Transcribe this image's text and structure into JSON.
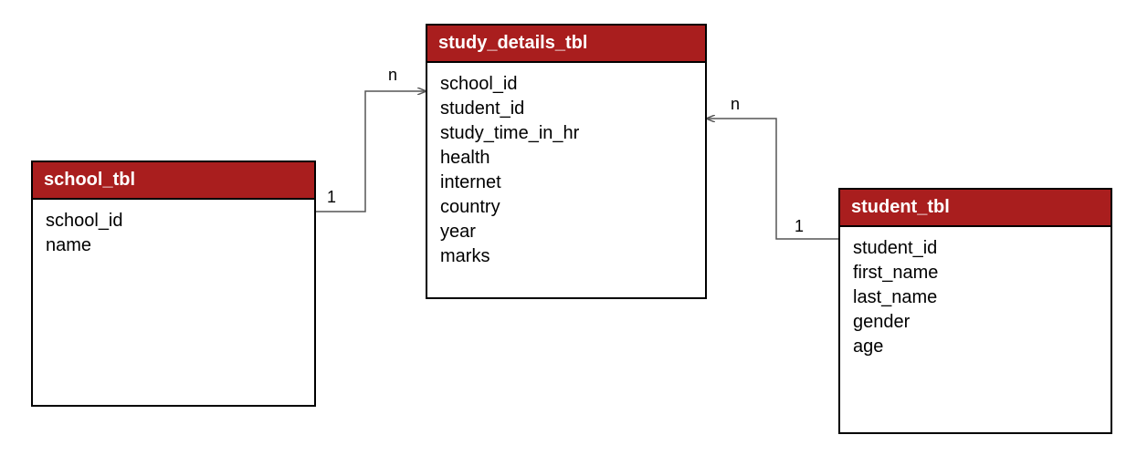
{
  "diagram": {
    "entities": {
      "school": {
        "title": "school_tbl",
        "fields": [
          "school_id",
          "name"
        ]
      },
      "study_details": {
        "title": "study_details_tbl",
        "fields": [
          "school_id",
          "student_id",
          "study_time_in_hr",
          "health",
          "internet",
          "country",
          "year",
          "marks"
        ]
      },
      "student": {
        "title": "student_tbl",
        "fields": [
          "student_id",
          "first_name",
          "last_name",
          "gender",
          "age"
        ]
      }
    },
    "relationships": {
      "school_to_study": {
        "from_card": "1",
        "to_card": "n"
      },
      "student_to_study": {
        "from_card": "1",
        "to_card": "n"
      }
    }
  }
}
